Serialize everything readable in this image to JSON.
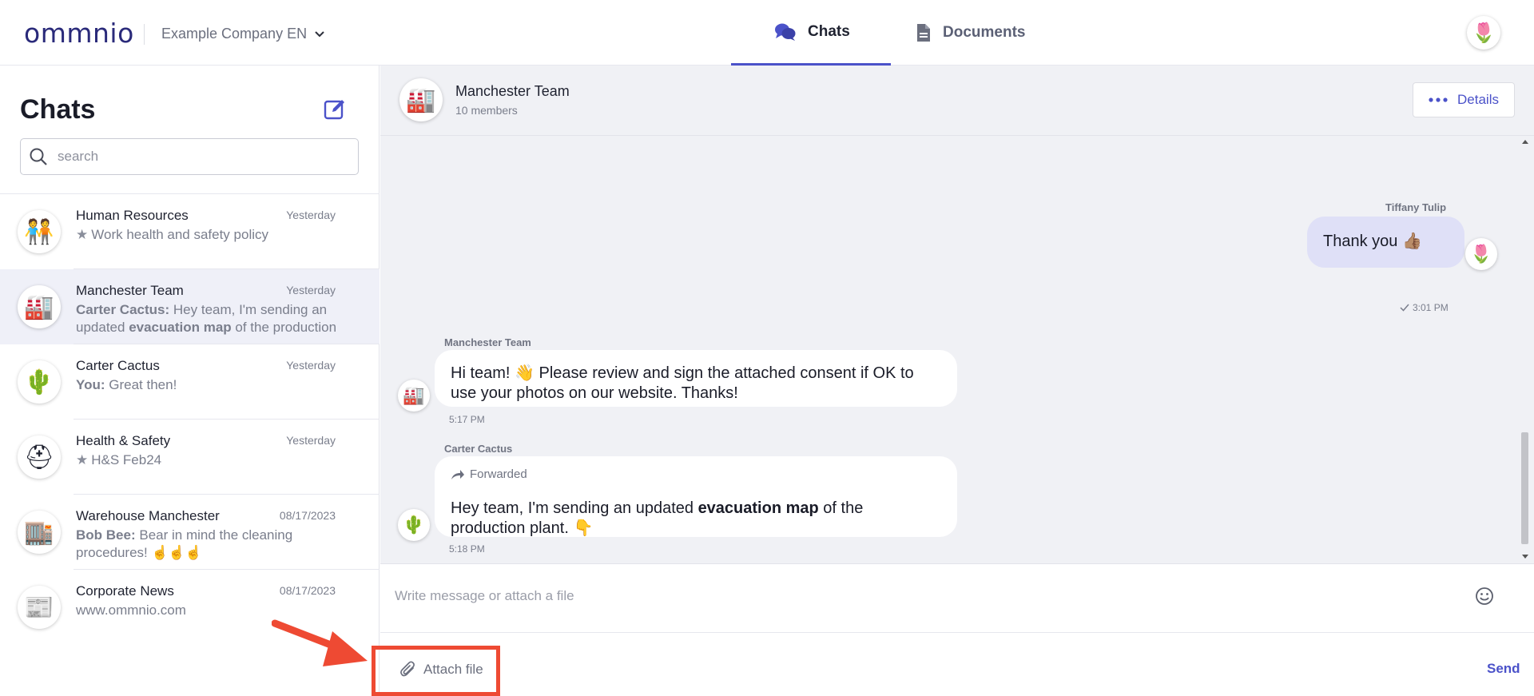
{
  "header": {
    "logo": "ommnio",
    "company": "Example Company EN",
    "tabs": {
      "chats": "Chats",
      "documents": "Documents"
    }
  },
  "sidebar": {
    "title": "Chats",
    "search_placeholder": "search",
    "chats": [
      {
        "name": "Human Resources",
        "date": "Yesterday",
        "starred": true,
        "preview_sender": "",
        "preview": "Work health and safety policy",
        "icon": "🧑‍🤝‍🧑"
      },
      {
        "name": "Manchester Team",
        "date": "Yesterday",
        "starred": false,
        "preview_sender": "Carter Cactus:",
        "preview_pre": "Hey team, I'm sending an updated ",
        "preview_bold": "evacuation map",
        "preview_post": " of the production plant.",
        "icon": "🏭"
      },
      {
        "name": "Carter Cactus",
        "date": "Yesterday",
        "starred": false,
        "preview_sender": "You:",
        "preview": "Great then!",
        "icon": "🌵"
      },
      {
        "name": "Health & Safety",
        "date": "Yesterday",
        "starred": true,
        "preview_sender": "",
        "preview": "H&S Feb24",
        "icon": "⛑"
      },
      {
        "name": "Warehouse Manchester",
        "date": "08/17/2023",
        "starred": false,
        "preview_sender": "Bob Bee:",
        "preview": "Bear in mind the cleaning procedures! ☝️☝️☝️",
        "icon": "🏬"
      },
      {
        "name": "Corporate News",
        "date": "08/17/2023",
        "starred": false,
        "preview_sender": "",
        "preview": "www.ommnio.com",
        "icon": "📰"
      }
    ]
  },
  "conversation": {
    "title": "Manchester Team",
    "subtitle": "10 members",
    "details_label": "Details",
    "messages": [
      {
        "sender": "Tiffany Tulip",
        "text": "Thank you 👍🏽",
        "time": "3:01 PM",
        "mine": true
      },
      {
        "sender": "Manchester Team",
        "text": "Hi team! 👋 Please review and sign the attached consent if OK to use your photos on our website. Thanks!",
        "time": "5:17 PM",
        "mine": false
      },
      {
        "sender": "Carter Cactus",
        "forwarded_label": "Forwarded",
        "text_pre": "Hey team, I'm sending an updated ",
        "text_bold": "evacuation map",
        "text_post": " of the production plant. 👇",
        "time": "5:18 PM",
        "mine": false
      }
    ],
    "composer": {
      "placeholder": "Write message or attach a file",
      "attach_label": "Attach file",
      "send_label": "Send"
    }
  },
  "colors": {
    "accent": "#4b52c9",
    "highlight": "#ee4a33",
    "own_bubble": "#dfe0f7",
    "conversation_bg": "#f0f1f5"
  },
  "icons": [
    "chevron-down-icon",
    "chat-bubbles-icon",
    "document-icon",
    "compose-icon",
    "search-icon",
    "star-icon",
    "more-dots-icon",
    "check-icon",
    "forward-icon",
    "emoji-icon",
    "paperclip-icon"
  ]
}
